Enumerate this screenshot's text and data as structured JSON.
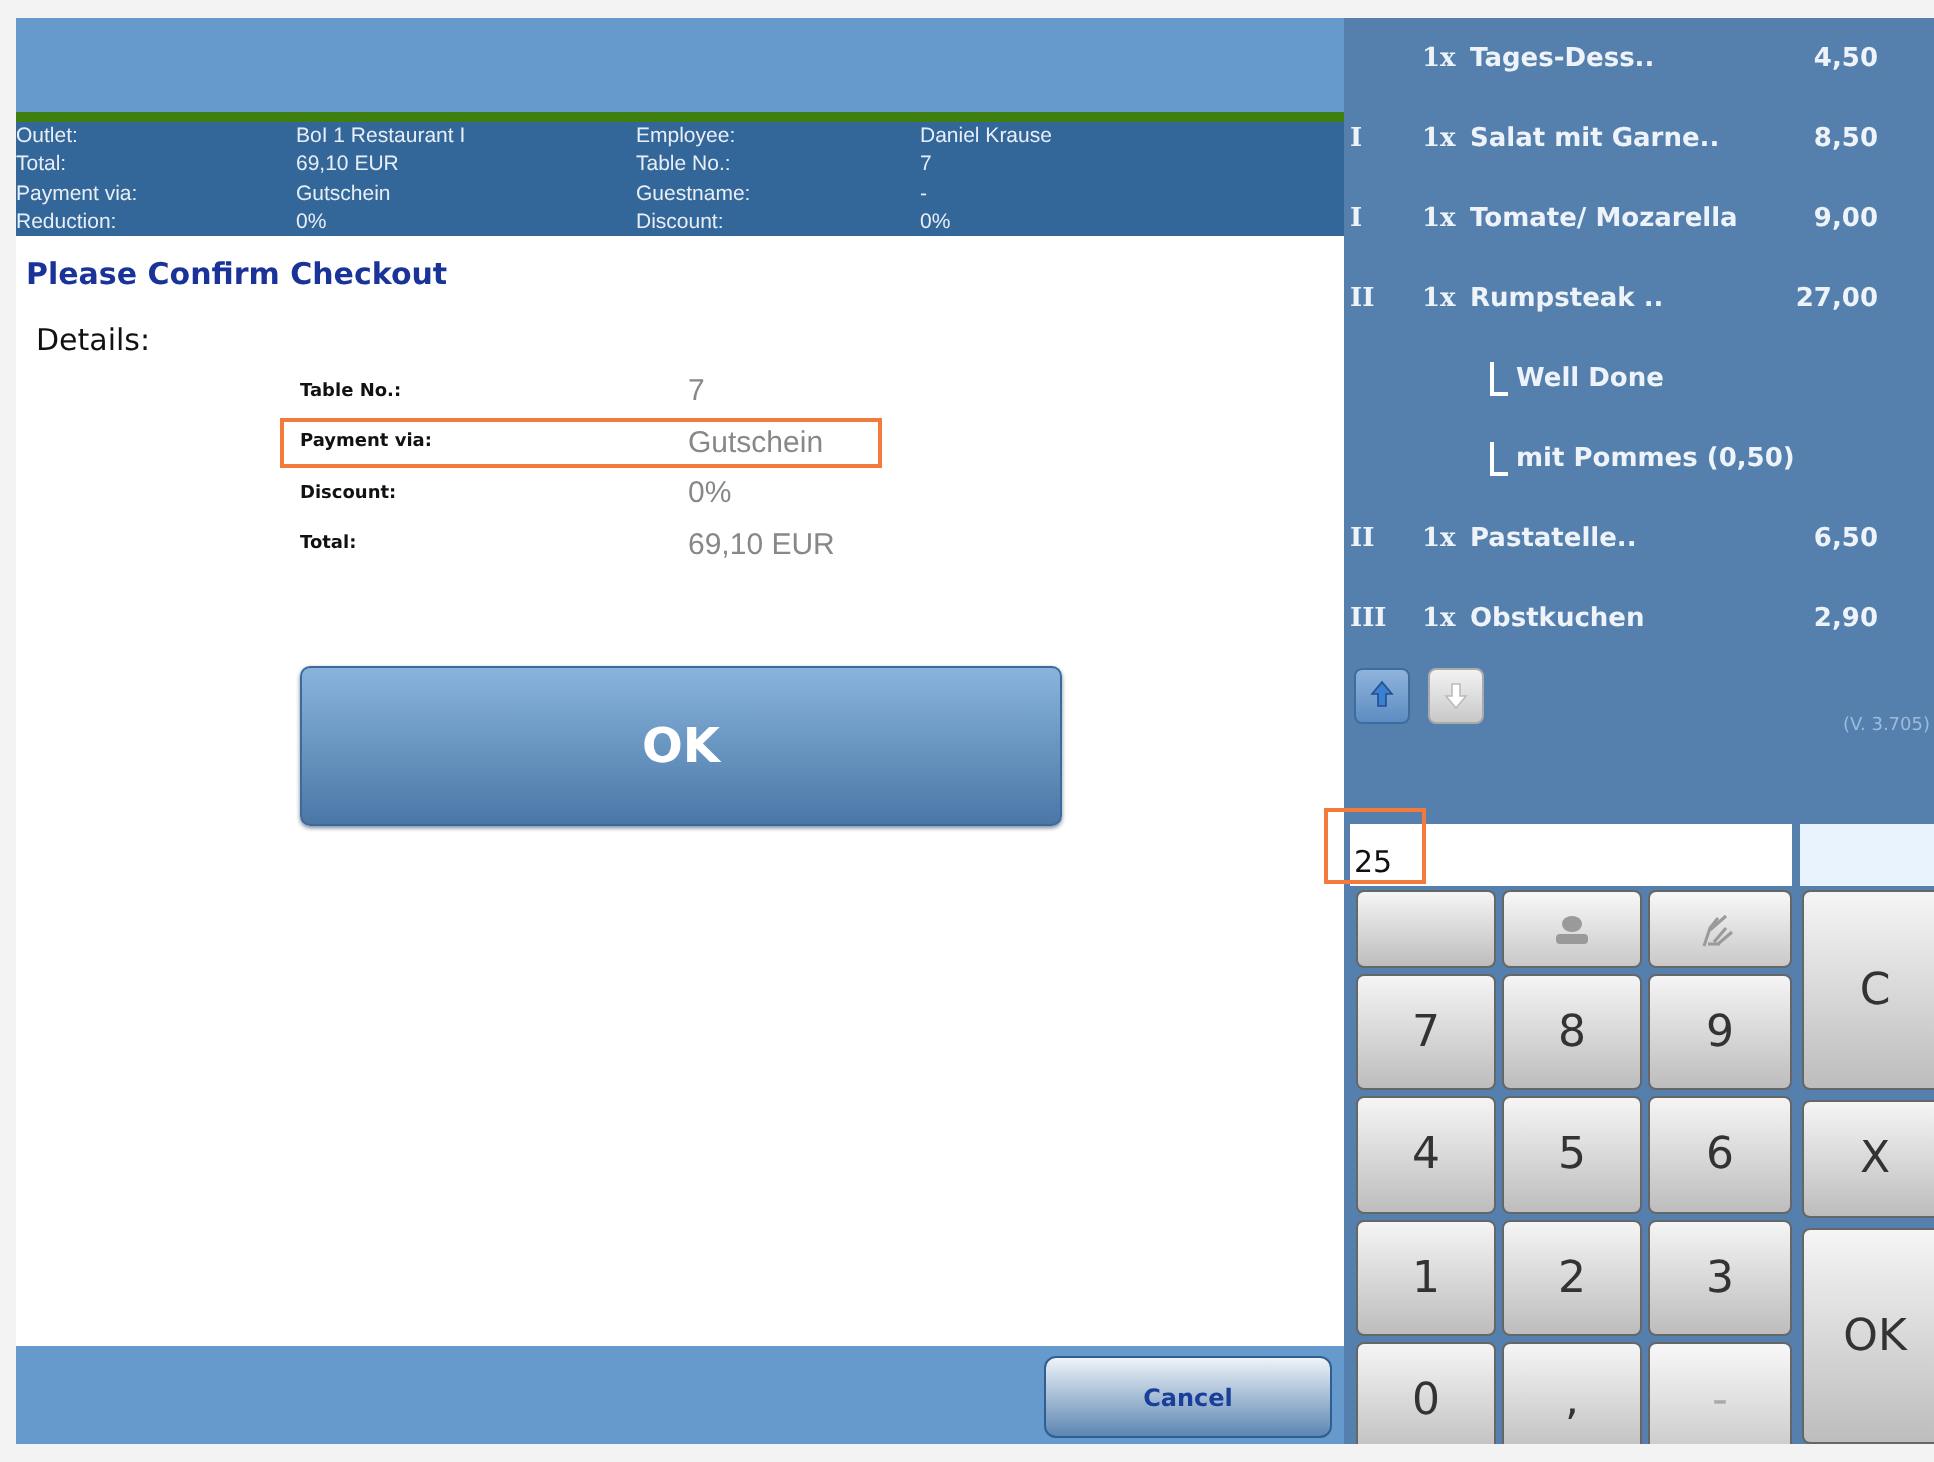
{
  "info_header": {
    "fields": [
      {
        "label": "Outlet:",
        "value": "BoI 1 Restaurant I"
      },
      {
        "label": "Employee:",
        "value": "Daniel Krause"
      },
      {
        "label": "Total:",
        "value": "69,10 EUR"
      },
      {
        "label": "Table No.:",
        "value": "7"
      },
      {
        "label": "Payment via:",
        "value": "Gutschein"
      },
      {
        "label": "Guestname:",
        "value": "-"
      },
      {
        "label": "Reduction:",
        "value": "0%"
      },
      {
        "label": "Discount:",
        "value": "0%"
      }
    ]
  },
  "dialog": {
    "title": "Please Confirm Checkout",
    "details_label": "Details:",
    "details": [
      {
        "label": "Table No.:",
        "value": "7",
        "highlighted": false
      },
      {
        "label": "Payment via:",
        "value": "Gutschein",
        "highlighted": true
      },
      {
        "label": "Discount:",
        "value": "0%",
        "highlighted": false
      },
      {
        "label": "Total:",
        "value": "69,10 EUR",
        "highlighted": false
      }
    ],
    "ok_button": "OK",
    "cancel_button": "Cancel"
  },
  "order": {
    "items": [
      {
        "qty": "1x",
        "name": "Tages-Dess..",
        "price": "4,50"
      },
      {
        "course": "I",
        "qty": "1x",
        "name": "Salat mit Garne..",
        "price": "8,50"
      },
      {
        "course": "I",
        "qty": "1x",
        "name": "Tomate/ Mozarella",
        "price": "9,00"
      },
      {
        "course": "II",
        "qty": "1x",
        "name": "Rumpsteak ..",
        "price": "27,00",
        "children": [
          {
            "name": "Well Done"
          },
          {
            "name": "mit Pommes (0,50)"
          }
        ]
      },
      {
        "course": "II",
        "qty": "1x",
        "name": "Pastatelle..",
        "price": "6,50"
      },
      {
        "course": "III",
        "qty": "1x",
        "name": "Obstkuchen",
        "price": "2,90"
      }
    ],
    "scroll_buttons": [
      {
        "kind": "up",
        "disabled": false
      },
      {
        "kind": "down",
        "disabled": true
      }
    ],
    "version": "(V. 3.705)"
  },
  "input": {
    "value": "25",
    "highlighted": true
  },
  "keypad": {
    "keys": [
      {
        "kind": "blank"
      },
      {
        "kind": "guest",
        "disabled": true
      },
      {
        "kind": "hand",
        "disabled": true
      },
      {
        "kind": "text",
        "label": "7",
        "disabled": false
      },
      {
        "kind": "text",
        "label": "8",
        "disabled": false
      },
      {
        "kind": "text",
        "label": "9",
        "disabled": false
      },
      {
        "kind": "text",
        "label": "4",
        "disabled": false
      },
      {
        "kind": "text",
        "label": "5",
        "disabled": false
      },
      {
        "kind": "text",
        "label": "6",
        "disabled": false
      },
      {
        "kind": "text",
        "label": "1",
        "disabled": false
      },
      {
        "kind": "text",
        "label": "2",
        "disabled": false
      },
      {
        "kind": "text",
        "label": "3",
        "disabled": false
      },
      {
        "kind": "text",
        "label": "0",
        "disabled": false
      },
      {
        "kind": "text",
        "label": ",",
        "disabled": false
      },
      {
        "kind": "text",
        "label": "-",
        "disabled": true
      }
    ],
    "actions": [
      "C",
      "X",
      "OK"
    ]
  }
}
